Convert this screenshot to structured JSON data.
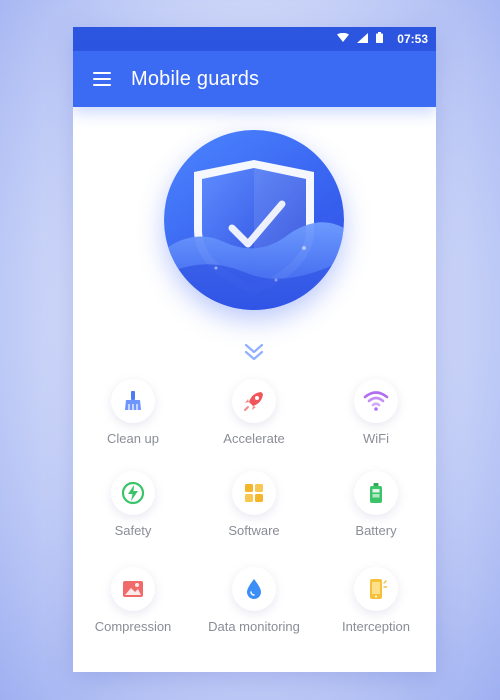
{
  "status_bar": {
    "time": "07:53"
  },
  "app_bar": {
    "title": "Mobile guards"
  },
  "features": [
    {
      "label": "Clean up",
      "icon": "broom-icon",
      "color": "#4f7cf5"
    },
    {
      "label": "Accelerate",
      "icon": "rocket-icon",
      "color": "#f0555a"
    },
    {
      "label": "WiFi",
      "icon": "wifi-icon",
      "color": "#b06ef0"
    },
    {
      "label": "Safety",
      "icon": "lightning-shield-icon",
      "color": "#3cc46a"
    },
    {
      "label": "Software",
      "icon": "apps-grid-icon",
      "color": "#f5b52a"
    },
    {
      "label": "Battery",
      "icon": "battery-icon",
      "color": "#3cc46a"
    },
    {
      "label": "Compression",
      "icon": "image-compress-icon",
      "color": "#f06a6a"
    },
    {
      "label": "Data monitoring",
      "icon": "water-drop-icon",
      "color": "#3b8ef5"
    },
    {
      "label": "Interception",
      "icon": "phone-block-icon",
      "color": "#f5c13a"
    }
  ],
  "colors": {
    "primary": "#3b6af3",
    "status_bar": "#2c55e0",
    "label_text": "#8a8d96"
  }
}
